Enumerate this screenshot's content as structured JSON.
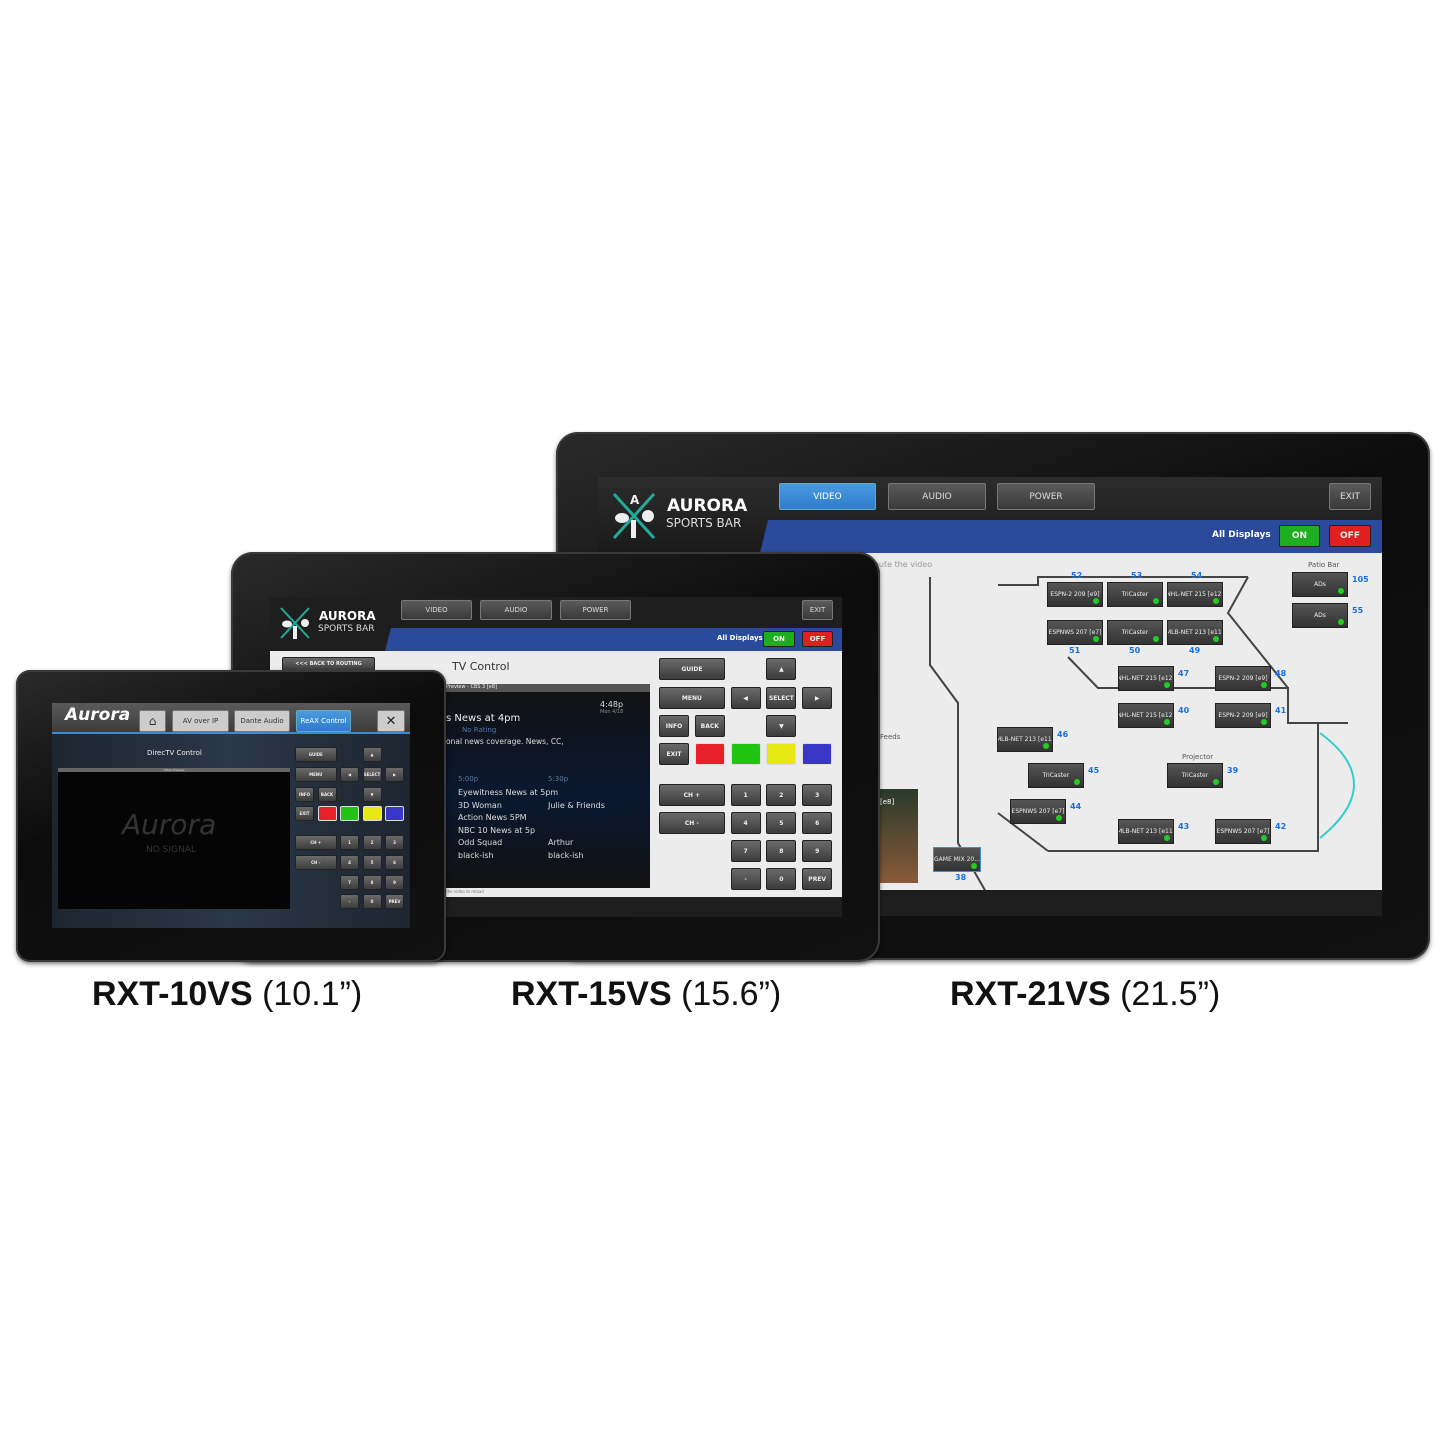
{
  "products": [
    {
      "model": "RXT-10VS",
      "size": "(10.1”)"
    },
    {
      "model": "RXT-15VS",
      "size": "(15.6”)"
    },
    {
      "model": "RXT-21VS",
      "size": "(21.5”)"
    }
  ],
  "colors": {
    "blue_bar": "#2c4a9c",
    "tab_active": "#3a8ad8",
    "on": "#1fae1f",
    "off": "#e02020",
    "room_number": "#1a6ee0"
  },
  "sports_bar": {
    "logo_title": "AURORA",
    "logo_subtitle": "SPORTS BAR",
    "tabs": [
      "VIDEO",
      "AUDIO",
      "POWER"
    ],
    "active_tab": "VIDEO",
    "exit": "EXIT",
    "all_displays": "All Displays",
    "on": "ON",
    "off": "OFF"
  },
  "large": {
    "hint": "oute the video",
    "side_label": "Feeds",
    "thumb_label": "[e8]",
    "patio_label": "Patio Bar",
    "projector_label": "Projector",
    "rooms": [
      {
        "label": "ESPN-2 209 [e9]",
        "number": "52"
      },
      {
        "label": "TriCaster",
        "number": "53"
      },
      {
        "label": "NHL-NET 215 [e12]",
        "number": "54"
      },
      {
        "label": "ESPNWS 207 [e7]",
        "number": "51"
      },
      {
        "label": "TriCaster",
        "number": "50"
      },
      {
        "label": "MLB-NET 213 [e11]",
        "number": "49"
      },
      {
        "label": "NHL-NET 215 [e12]",
        "number": "47"
      },
      {
        "label": "ESPN-2 209 [e9]",
        "number": "48"
      },
      {
        "label": "NHL-NET 215 [e12]",
        "number": "40"
      },
      {
        "label": "ESPN-2 209 [e9]",
        "number": "41"
      },
      {
        "label": "MLB-NET 213 [e11]",
        "number": "46"
      },
      {
        "label": "TriCaster",
        "number": "45"
      },
      {
        "label": "TriCaster",
        "number": "39"
      },
      {
        "label": "ESPNWS 207 [e7]",
        "number": "44"
      },
      {
        "label": "MLB-NET 213 [e11]",
        "number": "43"
      },
      {
        "label": "ESPNWS 207 [e7]",
        "number": "42"
      },
      {
        "label": "GAME MIX 20...",
        "number": "38"
      },
      {
        "label": "ADs",
        "number": "105"
      },
      {
        "label": "ADs",
        "number": "55"
      }
    ]
  },
  "medium": {
    "back_button": "<<< BACK TO ROUTING",
    "title": "TV Control",
    "preview_header": "Preview - CBS 3 [e8]",
    "time": "4:48p",
    "date": "Mon 4/18",
    "show_title": "s News at 4pm",
    "rating": "No Rating",
    "description": "onal news coverage. News, CC,",
    "slots": [
      "5:00p",
      "5:30p"
    ],
    "listings": [
      [
        "Eyewitness News at 5pm",
        ""
      ],
      [
        "3D Woman",
        "Julie & Friends"
      ],
      [
        "Action News 5PM",
        ""
      ],
      [
        "NBC 10 News at 5p",
        ""
      ],
      [
        "Odd Squad",
        "Arthur"
      ],
      [
        "black-ish",
        "black-ish"
      ]
    ],
    "footer": "the video to reload"
  },
  "small": {
    "logo": "Aurora",
    "tabs": [
      "AV over IP",
      "Dante Audio",
      "ReAX Control"
    ],
    "active_tab": "ReAX Control",
    "title": "DirecTV Control",
    "preview_header": "Video Preview",
    "watermark": "Aurora",
    "no_signal": "NO SIGNAL"
  },
  "remote": {
    "guide": "GUIDE",
    "menu": "MENU",
    "select": "SELECT",
    "info": "INFO",
    "back": "BACK",
    "exit": "EXIT",
    "chplus": "CH +",
    "chminus": "CH -",
    "n1": "1",
    "n2": "2",
    "n3": "3",
    "n4": "4",
    "n5": "5",
    "n6": "6",
    "n7": "7",
    "n8": "8",
    "n9": "9",
    "n0": "0",
    "dash": "-",
    "prev": "PREV",
    "up": "▲",
    "down": "▼",
    "left": "◀",
    "right": "▶",
    "red": "#e8202a",
    "green": "#22c414",
    "yellow": "#e8e812",
    "blue": "#3a36c8"
  }
}
